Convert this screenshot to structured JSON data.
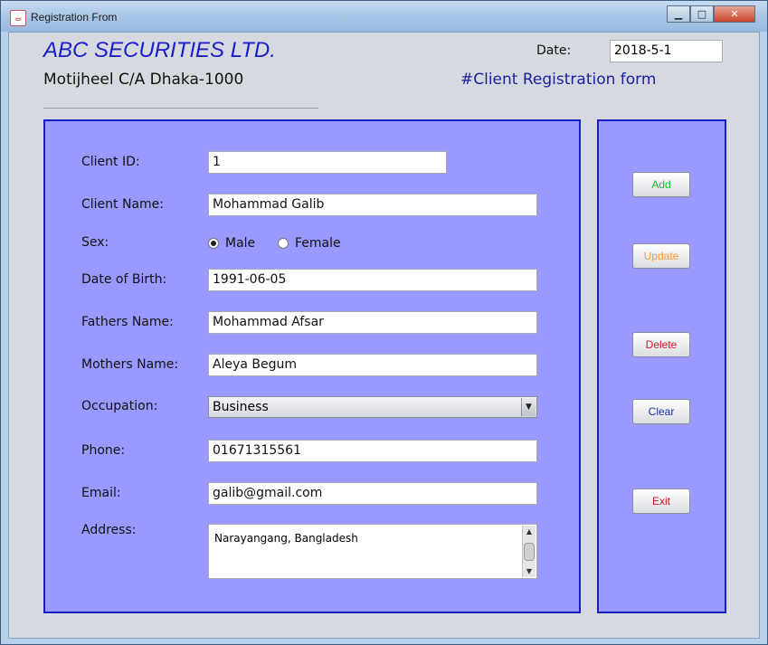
{
  "window": {
    "title": "Registration From"
  },
  "header": {
    "company": "ABC SECURITIES LTD.",
    "address": "Motijheel C/A Dhaka-1000",
    "date_label": "Date:",
    "date_value": "2018-5-1",
    "form_title": "#Client Registration form"
  },
  "form": {
    "client_id": {
      "label": "Client ID:",
      "value": "1"
    },
    "client_name": {
      "label": "Client Name:",
      "value": "Mohammad Galib"
    },
    "sex": {
      "label": "Sex:",
      "options": [
        "Male",
        "Female"
      ],
      "selected": "Male"
    },
    "dob": {
      "label": "Date of Birth:",
      "value": "1991-06-05"
    },
    "fathers_name": {
      "label": "Fathers Name:",
      "value": "Mohammad Afsar"
    },
    "mothers_name": {
      "label": "Mothers Name:",
      "value": "Aleya Begum"
    },
    "occupation": {
      "label": "Occupation:",
      "value": "Business"
    },
    "phone": {
      "label": "Phone:",
      "value": "01671315561"
    },
    "email": {
      "label": "Email:",
      "value": "galib@gmail.com"
    },
    "address": {
      "label": "Address:",
      "value": "Narayangang, Bangladesh"
    }
  },
  "actions": {
    "add": "Add",
    "update": "Update",
    "delete": "Delete",
    "clear": "Clear",
    "exit": "Exit"
  },
  "colors": {
    "panel": "#9999ff",
    "panel_border": "#1a1fc2",
    "company": "#1a1fc9",
    "add": "#22bb22",
    "update": "#ff9933",
    "delete": "#dd1122",
    "clear": "#1a2fb0",
    "exit": "#cc1122"
  }
}
